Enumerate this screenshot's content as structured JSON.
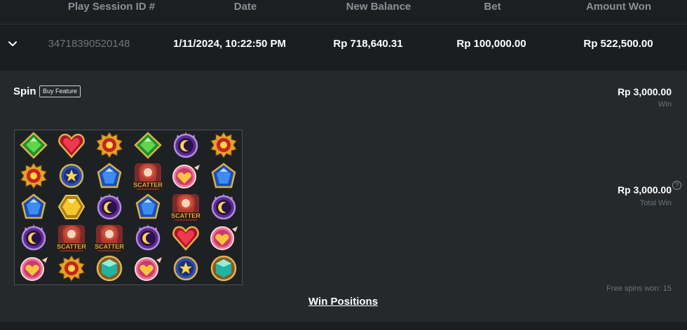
{
  "table": {
    "headers": [
      "Play Session ID #",
      "Date",
      "New Balance",
      "Bet",
      "Amount Won"
    ],
    "row": {
      "session_id": "34718390520148",
      "date": "1/11/2024, 10:22:50 PM",
      "new_balance": "Rp 718,640.31",
      "bet": "Rp 100,000.00",
      "amount_won": "Rp 522,500.00"
    }
  },
  "detail": {
    "spin_label": "Spin",
    "buy_feature_label": "Buy Feature",
    "win_amount": "Rp 3,000.00",
    "win_label": "Win",
    "total_win_amount": "Rp 3,000.00",
    "total_win_label": "Total Win",
    "help_glyph": "?",
    "free_spins": "Free spins won: 15",
    "win_positions_label": "Win Positions",
    "grid": [
      [
        "green-gem",
        "red-heart-gem",
        "sun-emblem",
        "green-gem",
        "moon-emblem",
        "sun-emblem"
      ],
      [
        "sun-emblem",
        "star-emblem",
        "blue-gem",
        "scatter",
        "heart-medallion",
        "blue-gem"
      ],
      [
        "blue-gem",
        "yellow-gem",
        "moon-emblem",
        "blue-gem",
        "scatter",
        "moon-emblem"
      ],
      [
        "moon-emblem",
        "scatter",
        "scatter",
        "moon-emblem",
        "red-heart-gem",
        "heart-medallion"
      ],
      [
        "heart-medallion",
        "sun-emblem",
        "teal-gem",
        "heart-medallion",
        "star-emblem",
        "teal-gem"
      ]
    ],
    "scatter_text": "SCATTER"
  },
  "colors": {
    "background": "#1b1e20",
    "panel": "#25292c",
    "header_text": "#8a9096",
    "text": "#ffffff"
  }
}
